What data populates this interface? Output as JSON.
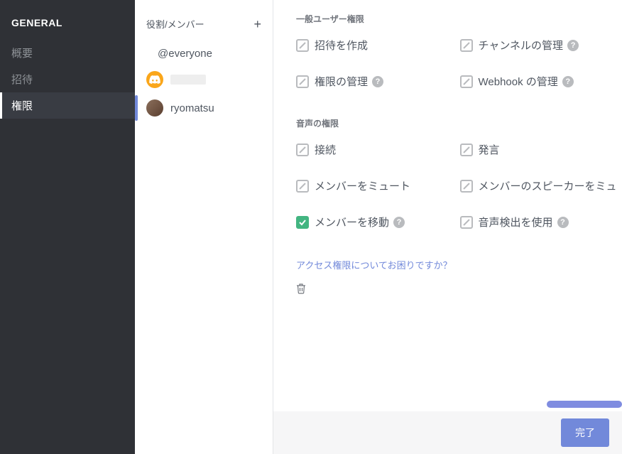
{
  "sidebar": {
    "title": "GENERAL",
    "items": [
      "概要",
      "招待",
      "権限"
    ],
    "activeIndex": 2
  },
  "roles": {
    "header": "役割/メンバー",
    "items": [
      {
        "label": "@everyone",
        "type": "everyone"
      },
      {
        "label": "",
        "type": "discord"
      },
      {
        "label": "ryomatsu",
        "type": "user"
      }
    ],
    "selectedIndex": 2
  },
  "permissions": {
    "generalSection": {
      "title": "一般ユーザー権限",
      "items": [
        {
          "label": "招待を作成",
          "checked": false,
          "help": false
        },
        {
          "label": "チャンネルの管理",
          "checked": false,
          "help": true
        },
        {
          "label": "権限の管理",
          "checked": false,
          "help": true
        },
        {
          "label": "Webhook の管理",
          "checked": false,
          "help": true
        }
      ]
    },
    "voiceSection": {
      "title": "音声の権限",
      "items": [
        {
          "label": "接続",
          "checked": false,
          "help": false
        },
        {
          "label": "発言",
          "checked": false,
          "help": false
        },
        {
          "label": "メンバーをミュート",
          "checked": false,
          "help": false
        },
        {
          "label": "メンバーのスピーカーをミュ",
          "checked": false,
          "help": false
        },
        {
          "label": "メンバーを移動",
          "checked": true,
          "help": true
        },
        {
          "label": "音声検出を使用",
          "checked": false,
          "help": true
        }
      ]
    },
    "helpLink": "アクセス権限についてお困りですか？"
  },
  "footer": {
    "doneLabel": "完了"
  }
}
